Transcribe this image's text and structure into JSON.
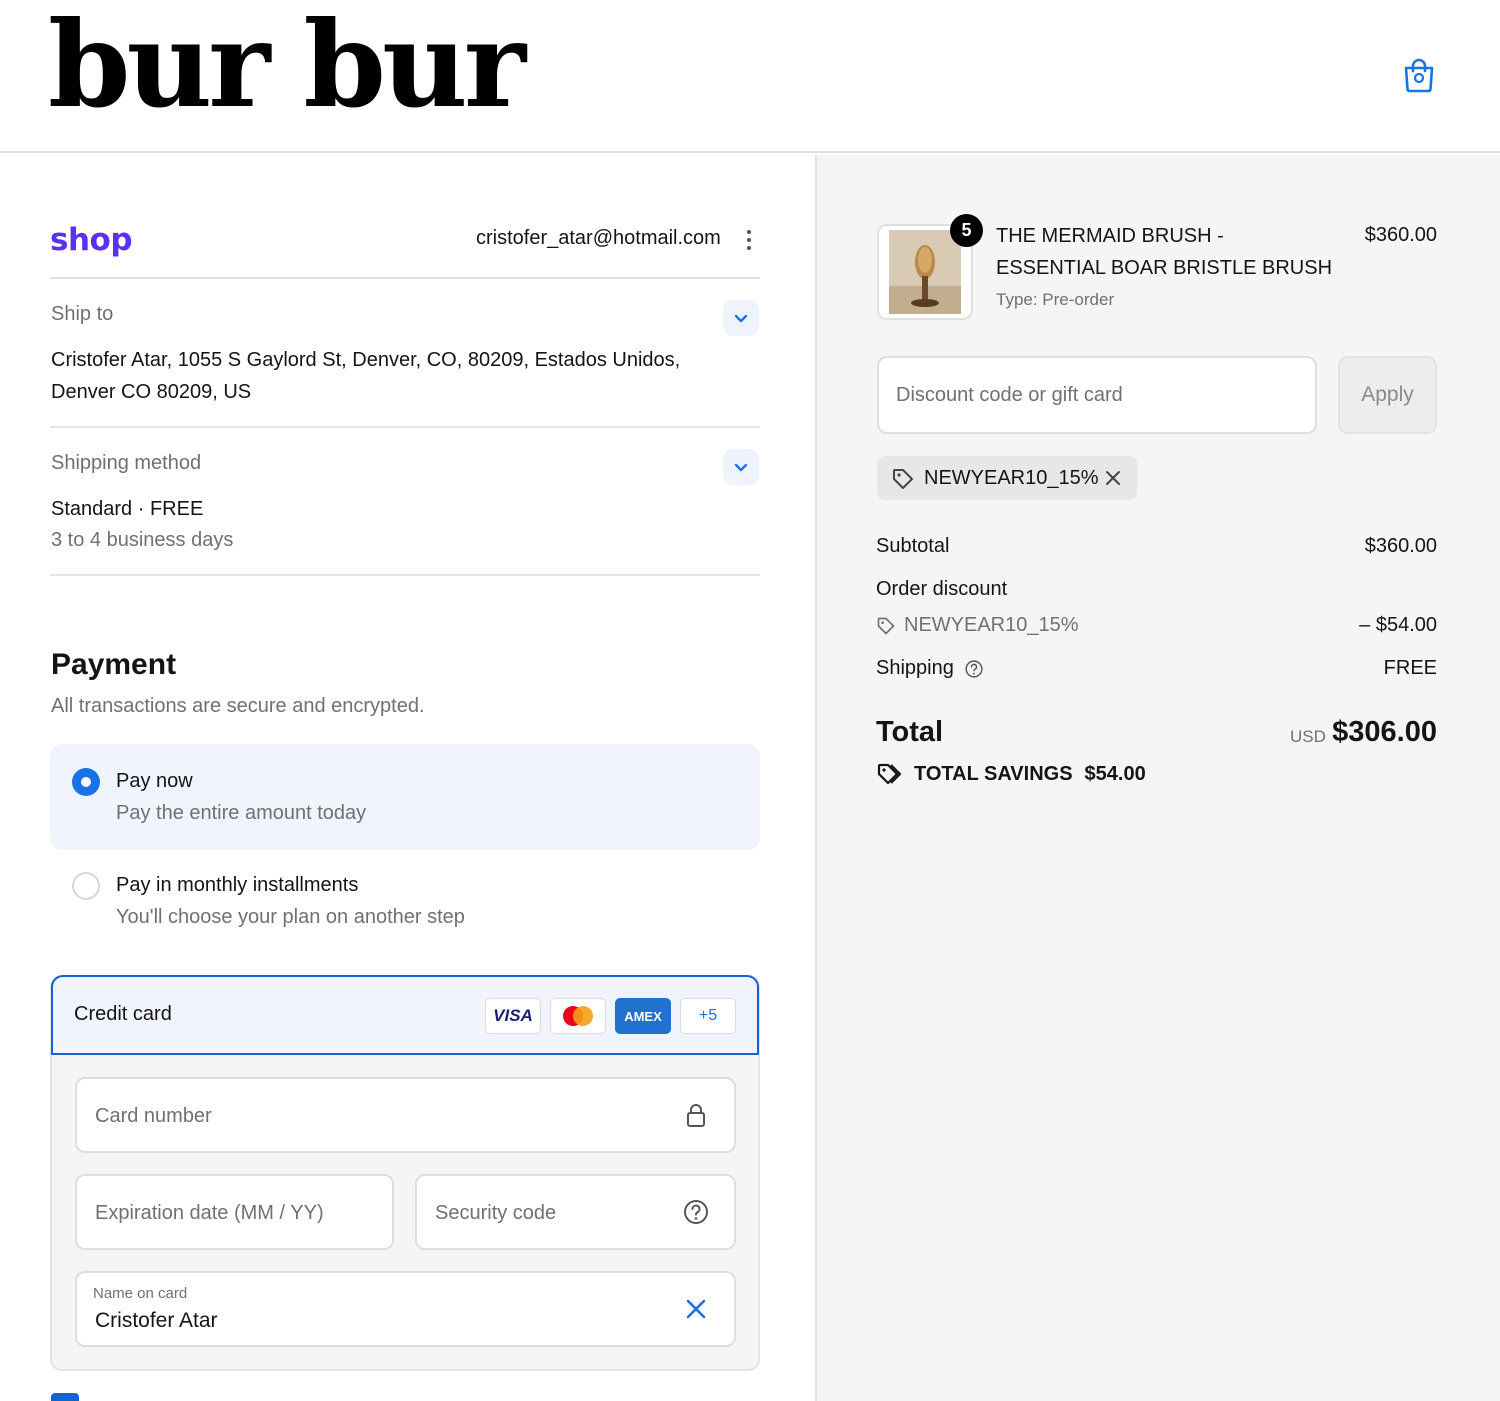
{
  "header": {
    "logo": "bur bur",
    "cart_icon": "shopping-bag-icon",
    "accent": "#1773e6"
  },
  "account": {
    "shop_logo": "shop",
    "email": "cristofer_atar@hotmail.com"
  },
  "ship_to": {
    "label": "Ship to",
    "address_line1": "Cristofer Atar, 1055 S Gaylord St, Denver, CO, 80209, Estados Unidos,",
    "address_line2": "Denver CO 80209, US"
  },
  "shipping_method": {
    "label": "Shipping method",
    "name": "Standard · FREE",
    "eta": "3 to 4 business days"
  },
  "payment": {
    "title": "Payment",
    "subtitle": "All transactions are secure and encrypted.",
    "options": [
      {
        "title": "Pay now",
        "subtitle": "Pay the entire amount today",
        "selected": true
      },
      {
        "title": "Pay in monthly installments",
        "subtitle": "You'll choose your plan on another step",
        "selected": false
      }
    ],
    "credit_card": {
      "label": "Credit card",
      "badges": {
        "visa": "VISA",
        "amex": "AMEX",
        "more": "+5"
      },
      "card_number_placeholder": "Card number",
      "expiration_placeholder": "Expiration date (MM / YY)",
      "security_placeholder": "Security code",
      "name_label": "Name on card",
      "name_value": "Cristofer Atar"
    }
  },
  "order": {
    "item": {
      "quantity": "5",
      "name": "THE MERMAID BRUSH - ESSENTIAL BOAR BRISTLE BRUSH",
      "type": "Type: Pre-order",
      "price": "$360.00"
    },
    "discount_placeholder": "Discount code or gift card",
    "apply_label": "Apply",
    "applied_code": "NEWYEAR10_15%",
    "subtotal_label": "Subtotal",
    "subtotal_value": "$360.00",
    "order_discount_label": "Order discount",
    "discount_code": "NEWYEAR10_15%",
    "discount_value": "– $54.00",
    "shipping_label": "Shipping",
    "shipping_value": "FREE",
    "total_label": "Total",
    "currency": "USD",
    "total_value": "$306.00",
    "savings_label": "TOTAL SAVINGS",
    "savings_value": "$54.00"
  }
}
